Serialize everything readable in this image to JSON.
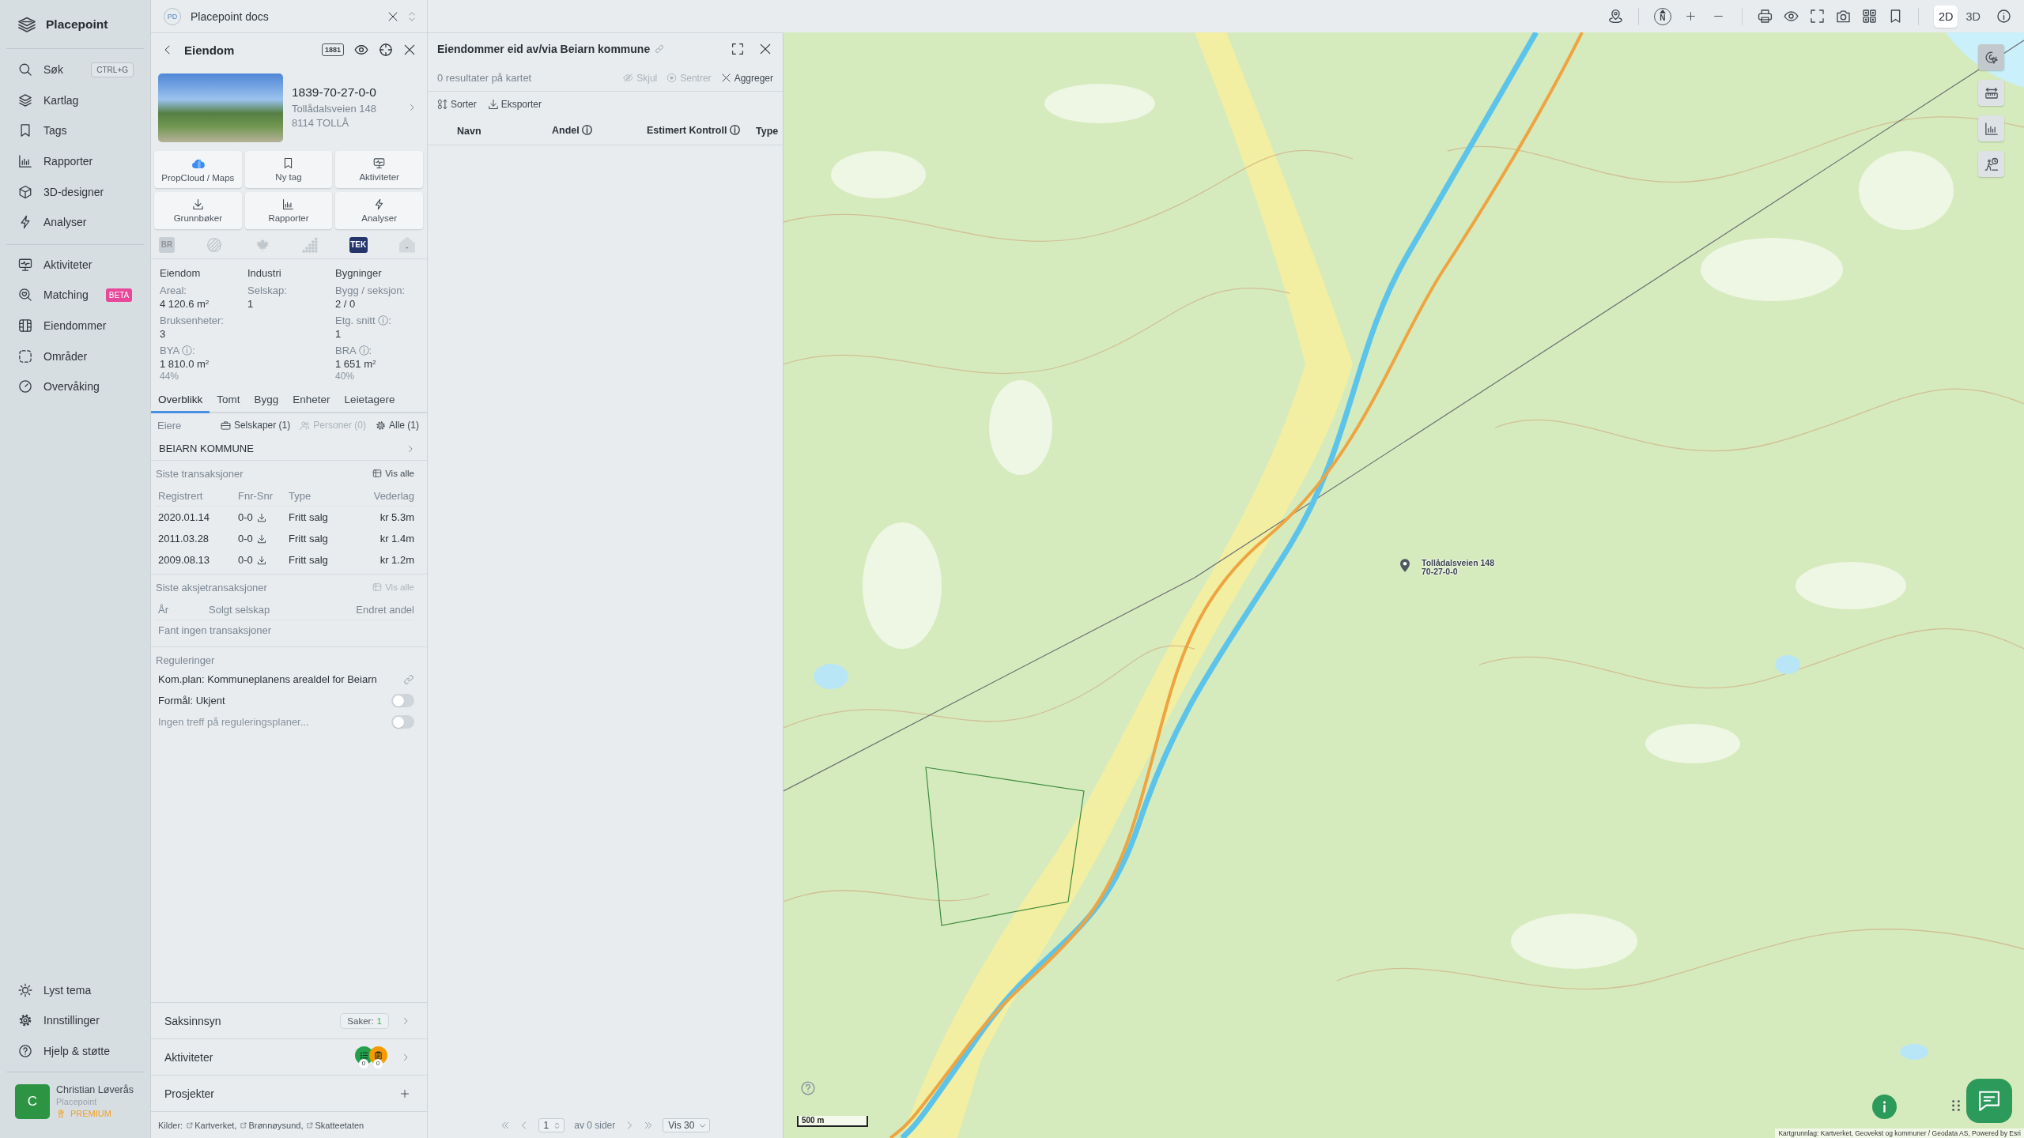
{
  "sidebar": {
    "brand": "Placepoint",
    "nav_main": [
      {
        "label": "Søk",
        "shortcut": "CTRL+G",
        "selected": false
      },
      {
        "label": "Kartlag",
        "selected": false
      },
      {
        "label": "Tags",
        "selected": false
      },
      {
        "label": "Rapporter",
        "selected": false
      },
      {
        "label": "3D-designer",
        "selected": false
      },
      {
        "label": "Analyser",
        "selected": false
      }
    ],
    "nav_secondary": [
      {
        "label": "Aktiviteter",
        "selected": false
      },
      {
        "label": "Matching",
        "badge": "BETA",
        "selected": false
      },
      {
        "label": "Eiendommer",
        "selected": false
      },
      {
        "label": "Områder",
        "selected": false
      },
      {
        "label": "Overvåking",
        "selected": false
      }
    ],
    "nav_bottom": [
      {
        "label": "Lyst tema"
      },
      {
        "label": "Innstillinger"
      },
      {
        "label": "Hjelp & støtte"
      }
    ],
    "user": {
      "initial": "C",
      "name": "Christian Løverås",
      "organization": "Placepoint",
      "plan": "PREMIUM"
    }
  },
  "workspace_tab": {
    "initials": "PD",
    "title": "Placepoint docs"
  },
  "property_panel": {
    "title": "Eiendom",
    "directory_label": "1881",
    "property": {
      "id": "1839-70-27-0-0",
      "address": "Tollådalsveien 148",
      "postal": "8114 TOLLÅ"
    },
    "actions": [
      {
        "label": "PropCloud / Maps"
      },
      {
        "label": "Ny tag"
      },
      {
        "label": "Aktiviteter"
      },
      {
        "label": "Grunnbøker"
      },
      {
        "label": "Rapporter"
      },
      {
        "label": "Analyser"
      }
    ],
    "indicators": [
      {
        "kind": "text",
        "label": "BR",
        "active": false
      },
      {
        "kind": "stripes",
        "active": false
      },
      {
        "kind": "leaf",
        "active": false
      },
      {
        "kind": "steps",
        "active": false
      },
      {
        "kind": "text",
        "label": "TEK",
        "active": true
      },
      {
        "kind": "house",
        "label": "-",
        "active": false
      }
    ],
    "stats": [
      {
        "heading": "Eiendom",
        "fields": [
          {
            "label": "Areal:",
            "value": "4 120.6 m$^{2}$"
          },
          {
            "label": "Bruksenheter:",
            "value": "3"
          },
          {
            "label": "BYA ⓘ:",
            "value": "1 810.0 m$^{2}$",
            "share": "44%"
          }
        ]
      },
      {
        "heading": "Industri",
        "fields": [
          {
            "label": "Selskap:",
            "value": "1"
          }
        ]
      },
      {
        "heading": "Bygninger",
        "fields": [
          {
            "label": "Bygg / seksjon:",
            "value": "2 / 0"
          },
          {
            "label": "Etg. snitt ⓘ:",
            "value": "1"
          },
          {
            "label": "BRA ⓘ:",
            "value": "1 651 m$^{2}$",
            "share": "40%"
          }
        ]
      }
    ],
    "tabs": [
      {
        "label": "Overblikk",
        "selected": true
      },
      {
        "label": "Tomt",
        "selected": false
      },
      {
        "label": "Bygg",
        "selected": false
      },
      {
        "label": "Enheter",
        "selected": false
      },
      {
        "label": "Leietagere",
        "selected": false
      }
    ],
    "owners": {
      "label": "Eiere",
      "filters": [
        {
          "label": "Selskaper (1)",
          "disabled": false
        },
        {
          "label": "Personer (0)",
          "disabled": true
        },
        {
          "label": "Alle (1)",
          "disabled": false
        }
      ],
      "items": [
        {
          "name": "BEIARN KOMMUNE"
        }
      ]
    },
    "transactions": {
      "title": "Siste transaksjoner",
      "view_all": {
        "label": "Vis alle",
        "disabled": false
      },
      "columns": [
        "Registrert",
        "Fnr-Snr",
        "Type",
        "Vederlag"
      ],
      "rows": [
        {
          "registered": "2020.01.14",
          "plot": "0-0",
          "type": "Fritt salg",
          "price": "kr 5.3m"
        },
        {
          "registered": "2011.03.28",
          "plot": "0-0",
          "type": "Fritt salg",
          "price": "kr 1.4m"
        },
        {
          "registered": "2009.08.13",
          "plot": "0-0",
          "type": "Fritt salg",
          "price": "kr 1.2m"
        }
      ]
    },
    "share_transactions": {
      "title": "Siste aksjetransaksjoner",
      "view_all": {
        "label": "Vis alle",
        "disabled": true
      },
      "columns": [
        "År",
        "Solgt selskap",
        "Endret andel"
      ],
      "empty": "Fant ingen transaksjoner"
    },
    "regulations": {
      "title": "Reguleringer",
      "items": [
        {
          "kind": "link",
          "text": "Kom.plan: Kommuneplanens arealdel for Beiarn"
        },
        {
          "kind": "toggle",
          "text": "Formål: Ukjent",
          "on": false,
          "disabled": false
        },
        {
          "kind": "toggle",
          "text": "Ingen treff på reguleringsplaner...",
          "on": false,
          "disabled": true
        }
      ]
    },
    "sections": [
      {
        "kind": "cases",
        "title": "Saksinnsyn",
        "count_label": "Saker:",
        "count": "1"
      },
      {
        "kind": "activities",
        "title": "Aktiviteter",
        "counts": [
          {
            "count": "0",
            "color": "#23a04b"
          },
          {
            "count": "0",
            "color": "#f59b00"
          }
        ]
      },
      {
        "kind": "projects",
        "title": "Prosjekter"
      }
    ],
    "sources": {
      "label": "Kilder:",
      "links": [
        "Kartverket,",
        "Brønnøysund,",
        "Skatteetaten"
      ]
    }
  },
  "results_panel": {
    "title": "Eiendommer eid av/via Beiarn kommune",
    "summary": "0 resultater på kartet",
    "actions": [
      {
        "label": "Skjul",
        "disabled": true
      },
      {
        "label": "Sentrer",
        "disabled": true
      },
      {
        "label": "Aggreger",
        "disabled": false
      }
    ],
    "tools": [
      "Sorter",
      "Eksporter"
    ],
    "columns": [
      "Navn",
      "Andel ⓘ",
      "Estimert Kontroll ⓘ",
      "Type"
    ],
    "pager": {
      "page": "1",
      "total": "av 0 sider",
      "page_size": "Vis 30"
    }
  },
  "map": {
    "compass": "N",
    "view_modes": [
      {
        "label": "2D",
        "selected": true
      },
      {
        "label": "3D",
        "selected": false
      }
    ],
    "side_tools": [
      {
        "selected": true
      },
      {
        "selected": false
      },
      {
        "selected": false
      },
      {
        "selected": false
      }
    ],
    "marker": {
      "title": "Tollådalsveien 148",
      "subtitle": "70-27-0-0"
    },
    "scale": "500 m",
    "attribution": "Kartgrunnlag: Kartverket, Geovekst og kommuner / Geodata AS, Powered by Esri"
  }
}
